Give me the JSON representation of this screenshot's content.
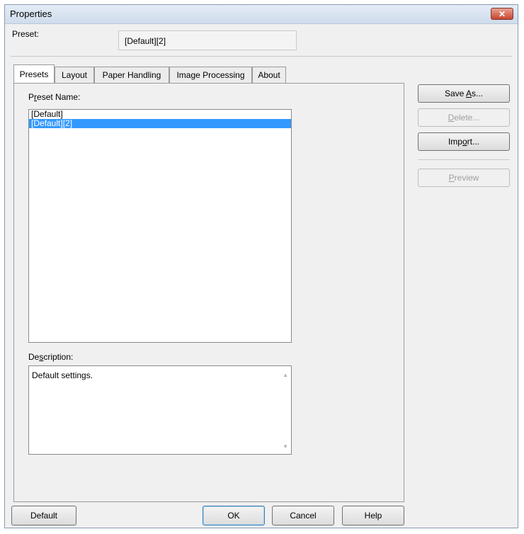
{
  "window": {
    "title": "Properties",
    "close_glyph": "✕"
  },
  "preset": {
    "label": "Preset:",
    "value": "[Default][2]"
  },
  "tabs": [
    {
      "label": "Presets"
    },
    {
      "label": "Layout"
    },
    {
      "label": "Paper Handling"
    },
    {
      "label": "Image Processing"
    },
    {
      "label": "About"
    }
  ],
  "presets_panel": {
    "preset_name_label": {
      "pre": "P",
      "key": "r",
      "post": "eset Name:"
    },
    "list": [
      "[Default]",
      "[Default][2]"
    ],
    "selected_index": 1,
    "description_label": {
      "pre": "De",
      "key": "s",
      "post": "cription:"
    },
    "description": "Default settings."
  },
  "side_buttons": {
    "save_as": {
      "pre": "Save ",
      "key": "A",
      "post": "s..."
    },
    "delete": {
      "pre": "",
      "key": "D",
      "post": "elete..."
    },
    "import": {
      "pre": "Imp",
      "key": "o",
      "post": "rt..."
    },
    "preview": {
      "pre": "",
      "key": "P",
      "post": "review"
    }
  },
  "bottom_buttons": {
    "default": "Default",
    "ok": "OK",
    "cancel": "Cancel",
    "help": "Help"
  }
}
